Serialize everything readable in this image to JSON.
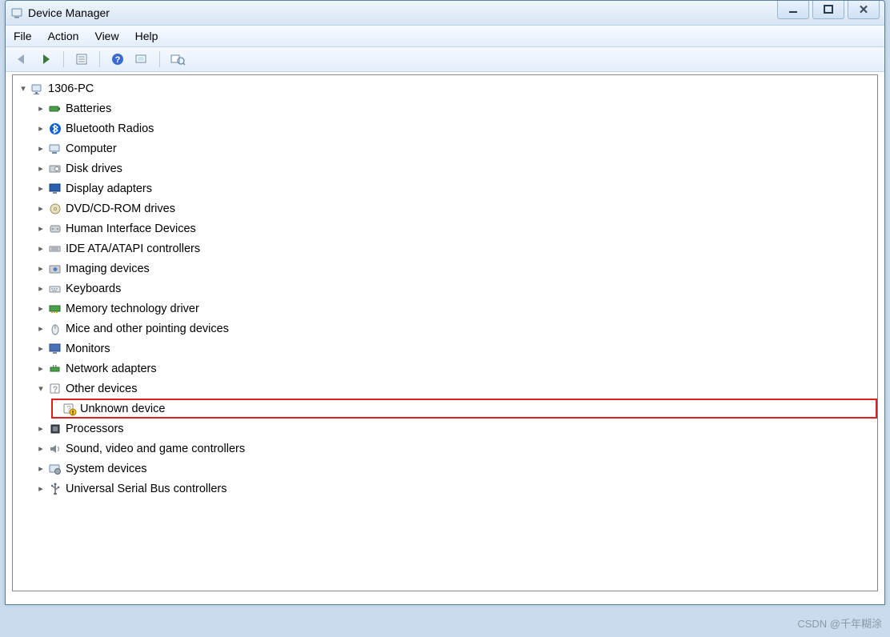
{
  "window": {
    "title": "Device Manager"
  },
  "menu": {
    "file": "File",
    "action": "Action",
    "view": "View",
    "help": "Help"
  },
  "toolbar": {
    "back": "Back",
    "forward": "Forward",
    "props": "Properties",
    "help": "Help",
    "scan": "Scan for hardware changes",
    "extra": "Show hidden devices"
  },
  "tree": {
    "root": "1306-PC",
    "items": [
      {
        "label": "Batteries",
        "icon": "battery"
      },
      {
        "label": "Bluetooth Radios",
        "icon": "bluetooth"
      },
      {
        "label": "Computer",
        "icon": "computer"
      },
      {
        "label": "Disk drives",
        "icon": "disk"
      },
      {
        "label": "Display adapters",
        "icon": "display"
      },
      {
        "label": "DVD/CD-ROM drives",
        "icon": "dvd"
      },
      {
        "label": "Human Interface Devices",
        "icon": "hid"
      },
      {
        "label": "IDE ATA/ATAPI controllers",
        "icon": "ide"
      },
      {
        "label": "Imaging devices",
        "icon": "imaging"
      },
      {
        "label": "Keyboards",
        "icon": "keyboard"
      },
      {
        "label": "Memory technology driver",
        "icon": "memory"
      },
      {
        "label": "Mice and other pointing devices",
        "icon": "mouse"
      },
      {
        "label": "Monitors",
        "icon": "monitor"
      },
      {
        "label": "Network adapters",
        "icon": "network"
      },
      {
        "label": "Other devices",
        "icon": "other",
        "expanded": true,
        "children": [
          {
            "label": "Unknown device",
            "icon": "unknown",
            "highlight": true
          }
        ]
      },
      {
        "label": "Processors",
        "icon": "cpu"
      },
      {
        "label": "Sound, video and game controllers",
        "icon": "sound"
      },
      {
        "label": "System devices",
        "icon": "system"
      },
      {
        "label": "Universal Serial Bus controllers",
        "icon": "usb"
      }
    ]
  },
  "watermark": "CSDN @千年糊涂"
}
